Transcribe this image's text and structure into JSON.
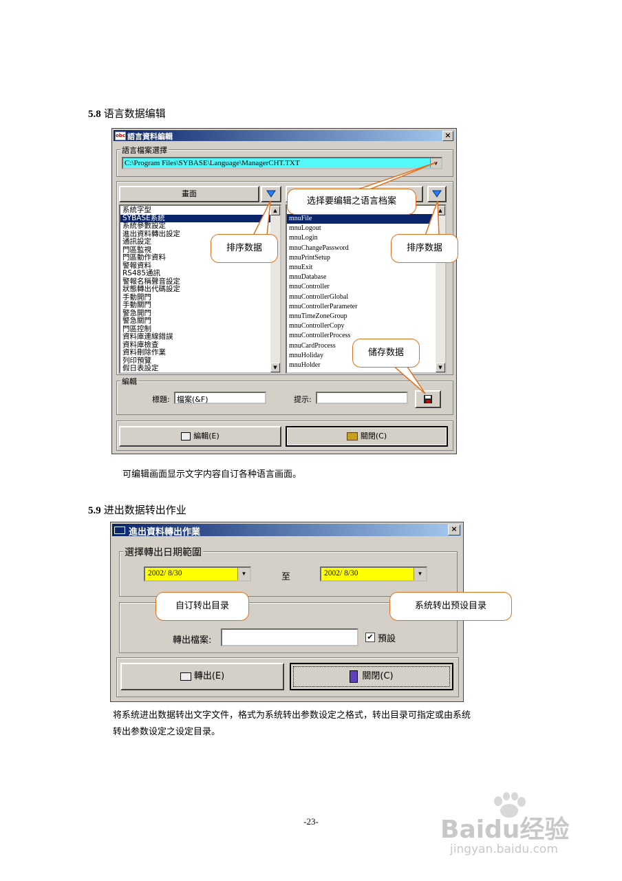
{
  "section_58": {
    "number": "5.8",
    "title": "语言数据编辑",
    "caption": "可编辑画面显示文字内容自订各种语言画面。"
  },
  "dialog1": {
    "title": "語言資料編輯",
    "app_icon": "obc",
    "group_file_label": "語言檔案選擇",
    "file_path": "C:\\Program Files\\SYBASE\\Language\\ManagerCHT.TXT",
    "left_header": "畫面",
    "left_items": [
      "系統字型",
      "SYBASE系統",
      "系統參數設定",
      "進出資料轉出設定",
      "通訊設定",
      "門區監視",
      "門區動作資料",
      "警報資料",
      "RS485通訊",
      "警報名稱聲音設定",
      "狀態轉出代碼設定",
      "手動開門",
      "手動關門",
      "警急開門",
      "警急關門",
      "門區控制",
      "資料庫連線錯誤",
      "資料庫檢查",
      "資料刪除作業",
      "列印預覽",
      "假日表設定"
    ],
    "left_selected": 1,
    "right_items": [
      "mnuFile",
      "mnuLogout",
      "mnuLogin",
      "mnuChangePassword",
      "mnuPrintSetup",
      "mnuExit",
      "mnuDatabase",
      "mnuController",
      "mnuControllerGlobal",
      "mnuControllerParameter",
      "mnuTimeZoneGroup",
      "mnuControllerCopy",
      "mnuControllerProcess",
      "mnuCardProcess",
      "mnuHoliday",
      "mnuHolder"
    ],
    "right_selected": 0,
    "edit_group_label": "編輯",
    "title_label": "標題:",
    "title_value": "檔案(&F)",
    "hint_label": "提示:",
    "hint_value": "",
    "edit_button": "編輯(E)",
    "close_button": "關閉(C)",
    "callout_select": "选择要编辑之语言档案",
    "callout_sort_left": "排序数据",
    "callout_sort_right": "排序数据",
    "callout_save": "储存数据"
  },
  "section_59": {
    "number": "5.9",
    "title": "进出数据转出作业",
    "body_line1": "将系统进出数据转出文字文件，格式为系统转出参数设定之格式，转出目录可指定或由系统",
    "body_line2": "转出参数设定之设定目录。"
  },
  "dialog2": {
    "title": "進出資料轉出作業",
    "group_label": "選擇轉出日期範圍",
    "date_from": "2002/ 8/30",
    "to_label": "至",
    "date_to": "2002/ 8/30",
    "export_file_label": "轉出檔案:",
    "export_file_value": "",
    "default_checkbox_label": "預設",
    "default_checked": true,
    "export_button": "轉出(E)",
    "close_button": "關閉(C)",
    "callout_custom_dir": "自订转出目录",
    "callout_default_dir": "系统转出预设目录"
  },
  "page_number": "-23-",
  "watermark": {
    "line1": "Baidu经验",
    "line2": "jingyan.baidu.com"
  }
}
